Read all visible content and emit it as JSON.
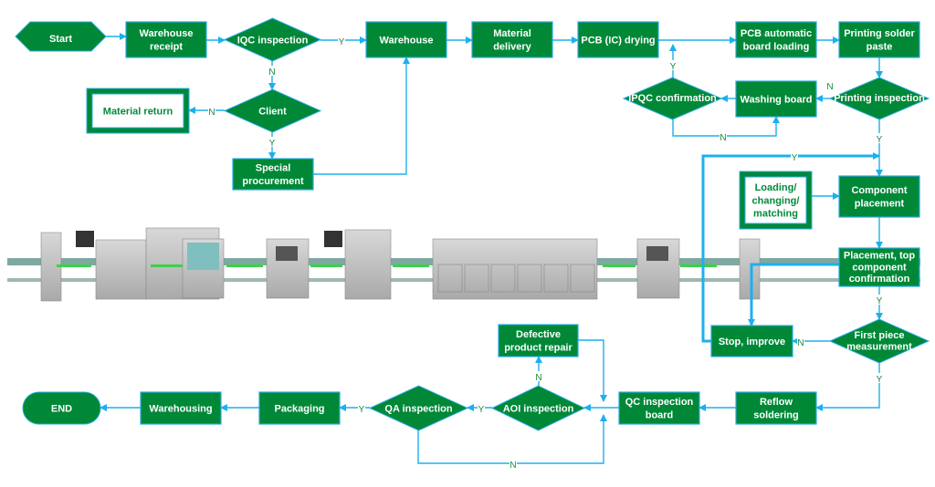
{
  "colors": {
    "node_fill": "#008837",
    "node_border": "#29abe2",
    "arrow": "#1cb0ee",
    "label": "#1a8a3a"
  },
  "nodes": {
    "start": {
      "label": "Start",
      "shape": "hexagon"
    },
    "warehouse_receipt": {
      "label": "Warehouse receipt",
      "shape": "rect"
    },
    "iqc": {
      "label": "IQC inspection",
      "shape": "diamond"
    },
    "warehouse": {
      "label": "Warehouse",
      "shape": "rect"
    },
    "material_delivery": {
      "label": "Material delivery",
      "shape": "rect"
    },
    "pcb_drying": {
      "label": "PCB (IC) drying",
      "shape": "rect"
    },
    "pcb_loading": {
      "label": "PCB automatic board loading",
      "shape": "rect"
    },
    "printing_paste": {
      "label": "Printing solder paste",
      "shape": "rect"
    },
    "printing_inspection": {
      "label": "Printing inspection",
      "shape": "diamond"
    },
    "washing_board": {
      "label": "Washing board",
      "shape": "rect"
    },
    "ipqc": {
      "label": "IPQC confirmation",
      "shape": "diamond"
    },
    "client": {
      "label": "Client",
      "shape": "diamond"
    },
    "material_return": {
      "label": "Material return",
      "shape": "double-rect"
    },
    "special_procurement": {
      "label": "Special procurement",
      "shape": "rect"
    },
    "loading_changing": {
      "label": "Loading/ changing/ matching",
      "shape": "double-rect"
    },
    "component_placement": {
      "label": "Component placement",
      "shape": "rect"
    },
    "placement_confirm": {
      "label": "Placement, top component confirmation",
      "shape": "rect"
    },
    "first_piece": {
      "label": "First piece measurement",
      "shape": "diamond"
    },
    "stop_improve": {
      "label": "Stop, improve",
      "shape": "rect"
    },
    "reflow": {
      "label": "Reflow soldering",
      "shape": "rect"
    },
    "qc_board": {
      "label": "QC inspection board",
      "shape": "rect"
    },
    "aoi": {
      "label": "AOI inspection",
      "shape": "diamond"
    },
    "defective_repair": {
      "label": "Defective product repair",
      "shape": "rect"
    },
    "qa": {
      "label": "QA inspection",
      "shape": "diamond"
    },
    "packaging": {
      "label": "Packaging",
      "shape": "rect"
    },
    "warehousing": {
      "label": "Warehousing",
      "shape": "rect"
    },
    "end": {
      "label": "END",
      "shape": "stadium"
    }
  },
  "edges": [
    {
      "from": "start",
      "to": "warehouse_receipt",
      "label": ""
    },
    {
      "from": "warehouse_receipt",
      "to": "iqc",
      "label": ""
    },
    {
      "from": "iqc",
      "to": "warehouse",
      "label": "Y"
    },
    {
      "from": "iqc",
      "to": "client",
      "label": "N"
    },
    {
      "from": "client",
      "to": "material_return",
      "label": "N"
    },
    {
      "from": "client",
      "to": "special_procurement",
      "label": "Y"
    },
    {
      "from": "special_procurement",
      "to": "warehouse",
      "label": ""
    },
    {
      "from": "warehouse",
      "to": "material_delivery",
      "label": ""
    },
    {
      "from": "material_delivery",
      "to": "pcb_drying",
      "label": ""
    },
    {
      "from": "pcb_drying",
      "to": "pcb_loading",
      "label": ""
    },
    {
      "from": "pcb_loading",
      "to": "printing_paste",
      "label": ""
    },
    {
      "from": "printing_paste",
      "to": "printing_inspection",
      "label": ""
    },
    {
      "from": "printing_inspection",
      "to": "washing_board",
      "label": "N"
    },
    {
      "from": "washing_board",
      "to": "ipqc",
      "label": ""
    },
    {
      "from": "ipqc",
      "to": "pcb_drying",
      "label": "Y"
    },
    {
      "from": "ipqc",
      "to": "washing_board",
      "label": "N"
    },
    {
      "from": "printing_inspection",
      "to": "component_placement",
      "label": "Y"
    },
    {
      "from": "loading_changing",
      "to": "component_placement",
      "label": ""
    },
    {
      "from": "component_placement",
      "to": "placement_confirm",
      "label": ""
    },
    {
      "from": "placement_confirm",
      "to": "stop_improve",
      "label": ""
    },
    {
      "from": "placement_confirm",
      "to": "first_piece",
      "label": "Y"
    },
    {
      "from": "first_piece",
      "to": "stop_improve",
      "label": "N"
    },
    {
      "from": "stop_improve",
      "to": "component_placement",
      "label": "Y"
    },
    {
      "from": "first_piece",
      "to": "reflow",
      "label": "Y"
    },
    {
      "from": "reflow",
      "to": "qc_board",
      "label": ""
    },
    {
      "from": "qc_board",
      "to": "aoi",
      "label": ""
    },
    {
      "from": "aoi",
      "to": "defective_repair",
      "label": "N"
    },
    {
      "from": "defective_repair",
      "to": "qc_board",
      "label": ""
    },
    {
      "from": "aoi",
      "to": "qa",
      "label": "Y"
    },
    {
      "from": "qa",
      "to": "qc_board",
      "label": "N"
    },
    {
      "from": "qa",
      "to": "packaging",
      "label": "Y"
    },
    {
      "from": "packaging",
      "to": "warehousing",
      "label": ""
    },
    {
      "from": "warehousing",
      "to": "end",
      "label": ""
    }
  ]
}
